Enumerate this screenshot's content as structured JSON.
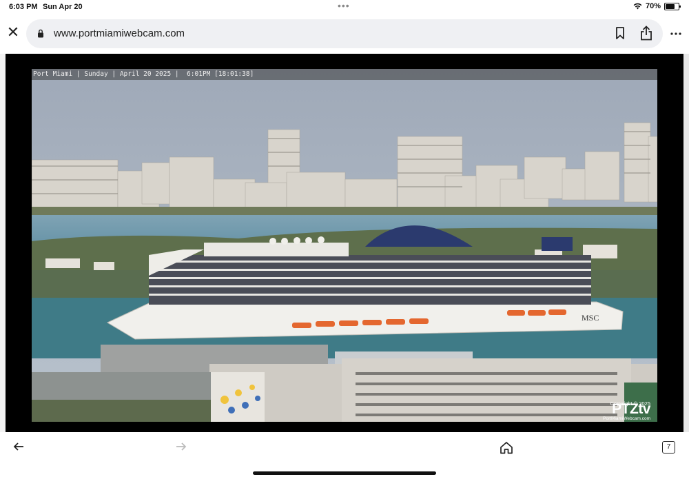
{
  "status_bar": {
    "time": "6:03 PM",
    "date": "Sun Apr 20",
    "dots": "•••",
    "battery": "70%",
    "battery_level": 0.7
  },
  "browser": {
    "url": "www.portmiamiwebcam.com",
    "tab_count": "7"
  },
  "webcam": {
    "overlay": "Port Miami | Sunday | April 20 2025 |  6:01PM [18:01:38]",
    "ship_logo": "MSC",
    "copyright": "Copyright © 2025",
    "brand": "PTZtv",
    "brand_site": "PortMiamiWebcam.com"
  },
  "icons": {
    "close": "close-icon",
    "lock": "lock-icon",
    "bookmark": "bookmark-icon",
    "share": "share-icon",
    "more": "more-icon",
    "back": "back-arrow-icon",
    "forward": "forward-arrow-icon",
    "home": "home-icon",
    "tabs": "tabs-icon",
    "wifi": "wifi-icon",
    "battery": "battery-icon"
  }
}
